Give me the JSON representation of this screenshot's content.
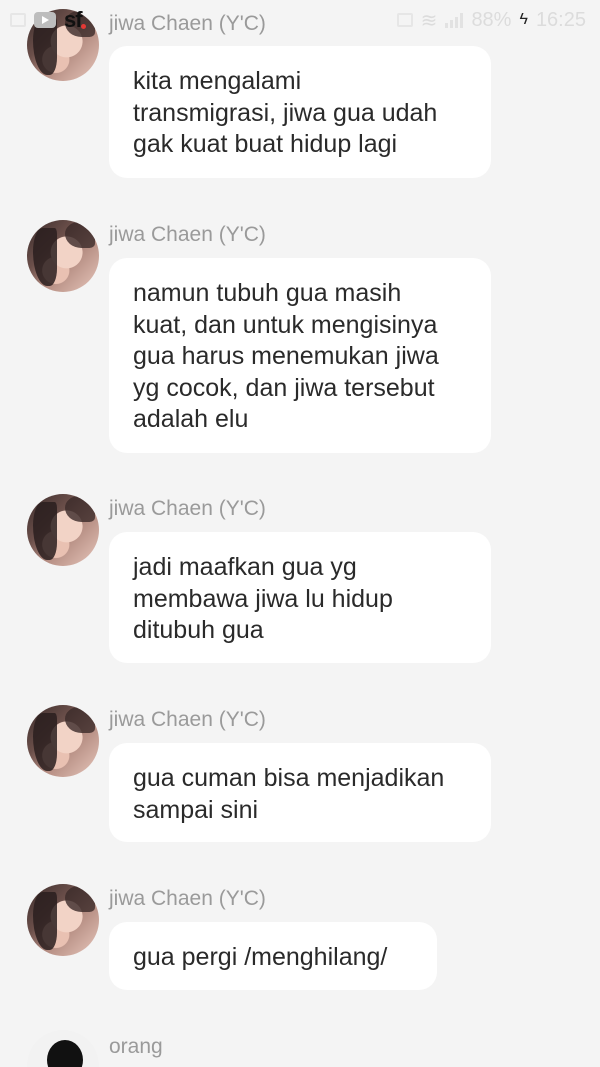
{
  "status_bar": {
    "icons": [
      "image-icon",
      "youtube-icon",
      "sf-app-icon",
      "sim-icon",
      "wifi-icon",
      "signal-icon",
      "charging-icon"
    ],
    "battery": "88%",
    "time": "16:25"
  },
  "messages": [
    {
      "sender": "jiwa Chaen (Y'C)",
      "avatar": "profile-photo-girl",
      "lines": [
        "kita mengalami",
        "transmigrasi, jiwa gua udah",
        "gak kuat buat hidup lagi"
      ]
    },
    {
      "sender": "jiwa Chaen (Y'C)",
      "avatar": "profile-photo-girl",
      "lines": [
        "namun tubuh gua masih",
        "kuat, dan untuk mengisinya",
        "gua harus menemukan jiwa",
        "yg cocok, dan jiwa tersebut",
        "adalah elu"
      ]
    },
    {
      "sender": "jiwa Chaen (Y'C)",
      "avatar": "profile-photo-girl",
      "lines": [
        "jadi maafkan gua yg",
        "membawa jiwa lu hidup",
        "ditubuh gua"
      ]
    },
    {
      "sender": "jiwa Chaen (Y'C)",
      "avatar": "profile-photo-girl",
      "lines": [
        "gua cuman bisa menjadikan",
        "sampai sini"
      ]
    },
    {
      "sender": "jiwa Chaen (Y'C)",
      "avatar": "profile-photo-girl",
      "lines": [
        "gua pergi /menghilang/"
      ]
    },
    {
      "sender": "orang",
      "avatar": "profile-silhouette",
      "lines": []
    }
  ],
  "colors": {
    "background": "#f4f4f4",
    "bubble": "#ffffff",
    "sender_text": "#9a9a9a",
    "message_text": "#2a2a2a"
  }
}
